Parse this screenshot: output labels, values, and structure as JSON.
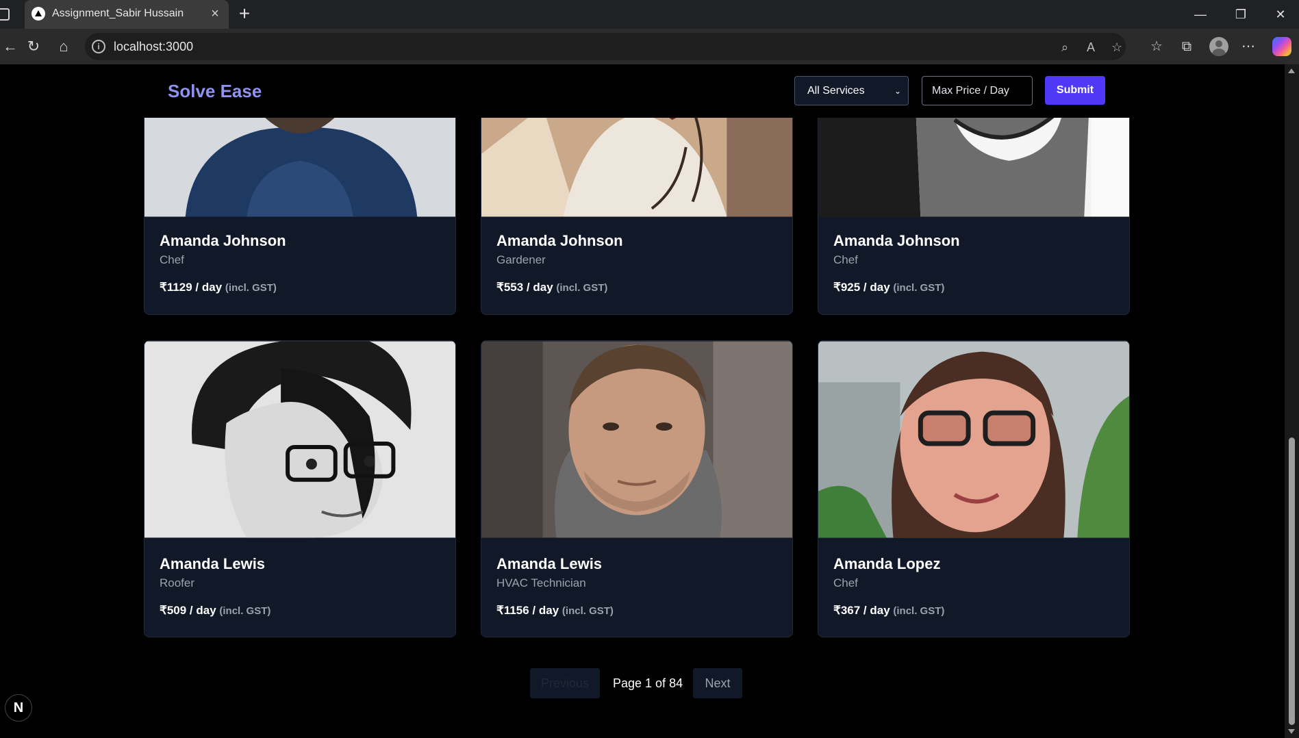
{
  "browser": {
    "tab_title": "Assignment_Sabir Hussain",
    "new_tab_icon": "plus-icon",
    "url": "localhost:3000"
  },
  "header": {
    "brand": "Solve Ease",
    "service_select": "All Services",
    "price_placeholder": "Max Price / Day",
    "submit_label": "Submit"
  },
  "cards": [
    {
      "name": "Amanda Johnson",
      "role": "Chef",
      "price": "₹1129 / day",
      "gst": "(incl. GST)"
    },
    {
      "name": "Amanda Johnson",
      "role": "Gardener",
      "price": "₹553 / day",
      "gst": "(incl. GST)"
    },
    {
      "name": "Amanda Johnson",
      "role": "Chef",
      "price": "₹925 / day",
      "gst": "(incl. GST)"
    },
    {
      "name": "Amanda Lewis",
      "role": "Roofer",
      "price": "₹509 / day",
      "gst": "(incl. GST)"
    },
    {
      "name": "Amanda Lewis",
      "role": "HVAC Technician",
      "price": "₹1156 / day",
      "gst": "(incl. GST)"
    },
    {
      "name": "Amanda Lopez",
      "role": "Chef",
      "price": "₹367 / day",
      "gst": "(incl. GST)"
    }
  ],
  "pagination": {
    "previous": "Previous",
    "page_text": "Page 1 of 84",
    "next": "Next"
  },
  "dev_badge": "N",
  "colors": {
    "accent": "#4f39f6",
    "brand": "#8f93f0",
    "card_bg": "#111827"
  }
}
